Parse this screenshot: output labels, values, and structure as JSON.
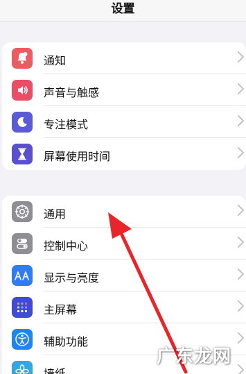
{
  "header": {
    "title": "设置"
  },
  "groups": [
    {
      "items": [
        {
          "label": "通知",
          "icon": "notification-bell-icon",
          "color": "#ec5c5f"
        },
        {
          "label": "声音与触感",
          "icon": "speaker-sound-icon",
          "color": "#ec4d66"
        },
        {
          "label": "专注模式",
          "icon": "moon-icon",
          "color": "#5b5bd6"
        },
        {
          "label": "屏幕使用时间",
          "icon": "hourglass-icon",
          "color": "#5a4fd0"
        }
      ]
    },
    {
      "items": [
        {
          "label": "通用",
          "icon": "gear-icon",
          "color": "#8e8e93"
        },
        {
          "label": "控制中心",
          "icon": "toggle-switches-icon",
          "color": "#8e8e93"
        },
        {
          "label": "显示与亮度",
          "icon": "text-size-aa-icon",
          "color": "#2f7cf6"
        },
        {
          "label": "主屏幕",
          "icon": "home-screen-grid-icon",
          "color": "#3d4bd8"
        },
        {
          "label": "辅助功能",
          "icon": "accessibility-person-icon",
          "color": "#1e86f0"
        },
        {
          "label": "墙纸",
          "icon": "wallpaper-flower-icon",
          "color": "#37a6e0"
        }
      ]
    }
  ],
  "annotation": {
    "color": "#e8252a"
  },
  "watermark": {
    "text": "广东龙网"
  }
}
